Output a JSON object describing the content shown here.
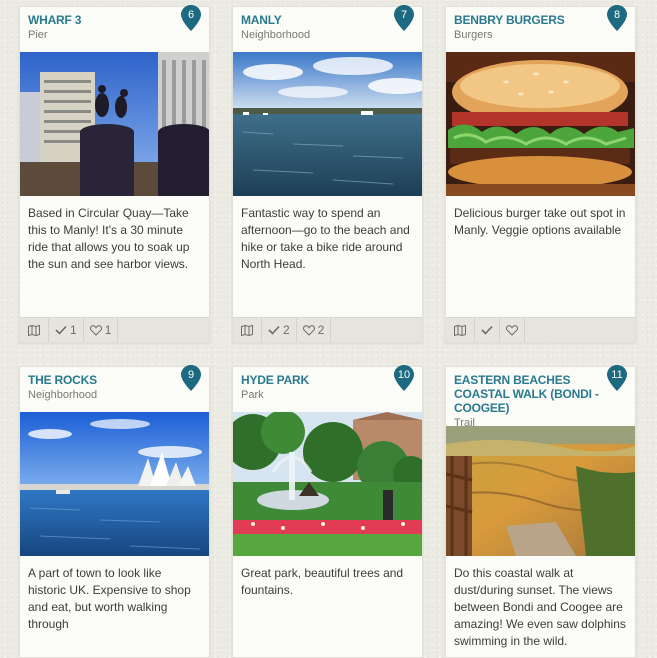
{
  "cards": [
    {
      "title": "WHARF 3",
      "category": "Pier",
      "number": "6",
      "description": "Based in Circular Quay—Take this to Manly! It's a 30 minute ride that allows you to soak up the sun and see harbor views.",
      "done_count": "1",
      "like_count": "1",
      "photo_icon": "wharf-photo"
    },
    {
      "title": "MANLY",
      "category": "Neighborhood",
      "number": "7",
      "description": "Fantastic way to spend an afternoon—go to the beach and hike or take a bike ride around North Head.",
      "done_count": "2",
      "like_count": "2",
      "photo_icon": "harbor-photo"
    },
    {
      "title": "BENBRY BURGERS",
      "category": "Burgers",
      "number": "8",
      "description": "Delicious burger take out spot in Manly. Veggie options available",
      "done_count": "",
      "like_count": "",
      "photo_icon": "burger-photo"
    },
    {
      "title": "THE ROCKS",
      "category": "Neighborhood",
      "number": "9",
      "description": "A part of town to look like historic UK. Expensive to shop and eat, but worth walking through",
      "photo_icon": "opera-house-photo"
    },
    {
      "title": "HYDE PARK",
      "category": "Park",
      "number": "10",
      "description": "Great park, beautiful trees and fountains.",
      "photo_icon": "park-photo"
    },
    {
      "title": "EASTERN BEACHES COASTAL WALK (BONDI - COOGEE)",
      "category": "Trail",
      "number": "11",
      "description": "Do this coastal walk at dust/during sunset. The views between Bondi and Coogee are amazing! We even saw dolphins swimming in the wild.",
      "photo_icon": "coastal-walk-photo"
    }
  ],
  "colors": {
    "accent": "#2a7a8f",
    "pin": "#1d6a80"
  }
}
